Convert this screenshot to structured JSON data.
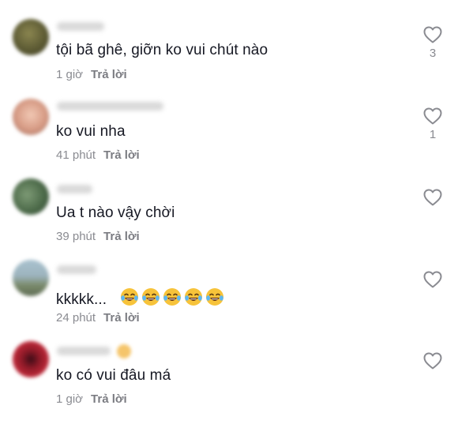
{
  "comments": [
    {
      "text": "tội bã ghê, giỡn ko vui chút nào",
      "time": "1 giờ",
      "reply_label": "Trả lời",
      "like_count": "3",
      "avatar_color": "#6b6a3f",
      "like_icon": "heart-outline-icon"
    },
    {
      "text": "ko vui nha",
      "time": "41 phút",
      "reply_label": "Trả lời",
      "like_count": "1",
      "avatar_color": "#c98f7a",
      "like_icon": "heart-outline-icon"
    },
    {
      "text": "Ua t nào vậy chời",
      "time": "39 phút",
      "reply_label": "Trả lời",
      "like_count": "",
      "avatar_color": "#4f6a4a",
      "like_icon": "heart-outline-icon"
    },
    {
      "text": "kkkkk...",
      "time": "24 phút",
      "reply_label": "Trả lời",
      "like_count": "",
      "avatar_color": "#8fa6b0",
      "emoji": "face-with-tears-of-joy",
      "emoji_count": 5,
      "like_icon": "heart-outline-icon"
    },
    {
      "text": "ko có vui đâu má",
      "time": "1 giờ",
      "reply_label": "Trả lời",
      "like_count": "",
      "avatar_color": "#9e1d2a",
      "like_icon": "heart-outline-icon"
    }
  ]
}
